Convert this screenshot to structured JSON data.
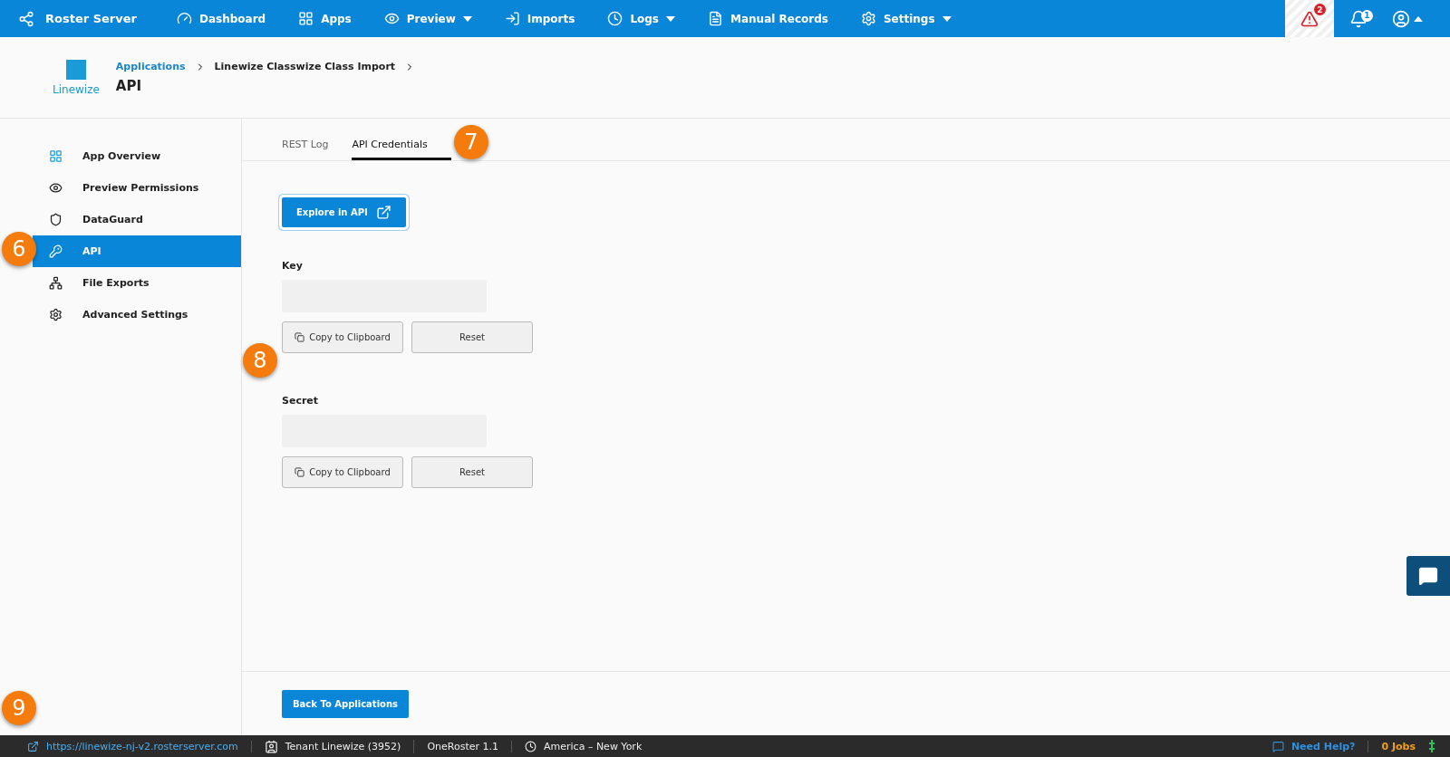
{
  "topbar": {
    "brand": "Roster Server",
    "nav": [
      {
        "label": "Dashboard",
        "dropdown": false
      },
      {
        "label": "Apps",
        "dropdown": false
      },
      {
        "label": "Preview",
        "dropdown": true
      },
      {
        "label": "Imports",
        "dropdown": false
      },
      {
        "label": "Logs",
        "dropdown": true
      },
      {
        "label": "Manual Records",
        "dropdown": false
      },
      {
        "label": "Settings",
        "dropdown": true
      }
    ],
    "alerts_badge": "2",
    "notifications_badge": "1"
  },
  "header": {
    "logo_text": "Linewize",
    "breadcrumbs": [
      "Applications",
      "Linewize Classwize Class Import"
    ],
    "title": "API"
  },
  "sidebar": {
    "items": [
      {
        "label": "App Overview",
        "selected": false
      },
      {
        "label": "Preview Permissions",
        "selected": false
      },
      {
        "label": "DataGuard",
        "selected": false
      },
      {
        "label": "API",
        "selected": true
      },
      {
        "label": "File Exports",
        "selected": false
      },
      {
        "label": "Advanced Settings",
        "selected": false
      }
    ]
  },
  "tabs": [
    {
      "label": "REST Log",
      "selected": false
    },
    {
      "label": "API Credentials",
      "selected": true
    }
  ],
  "explore_button": "Explore in API",
  "credentials": [
    {
      "label": "Key",
      "copy_button": "Copy to Clipboard",
      "reset_button": "Reset"
    },
    {
      "label": "Secret",
      "copy_button": "Copy to Clipboard",
      "reset_button": "Reset"
    }
  ],
  "back_button": "Back To Applications",
  "callouts": [
    "6",
    "7",
    "8",
    "9"
  ],
  "status_bar": {
    "url": "https://linewize-nj-v2.rosterserver.com",
    "tenant": "Tenant Linewize (3952)",
    "version": "OneRoster 1.1",
    "timezone": "America – New York",
    "help": "Need Help?",
    "jobs": "0 Jobs"
  }
}
